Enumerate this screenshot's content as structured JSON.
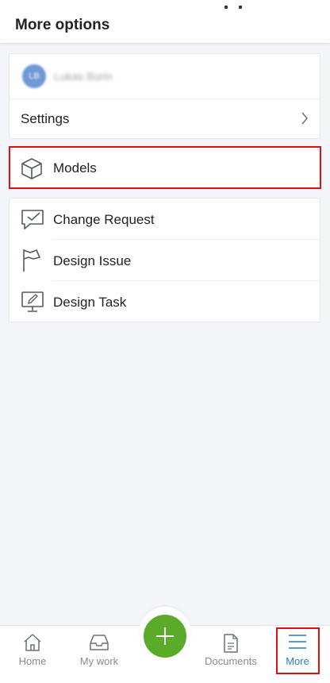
{
  "header": {
    "title": "More options"
  },
  "profile": {
    "initials": "LB",
    "name": "Lukas Burin"
  },
  "settings": {
    "label": "Settings"
  },
  "models": {
    "label": "Models"
  },
  "items": [
    {
      "label": "Change Request",
      "icon": "chat-check-icon"
    },
    {
      "label": "Design Issue",
      "icon": "flag-icon"
    },
    {
      "label": "Design Task",
      "icon": "monitor-pencil-icon"
    }
  ],
  "bottom_nav": {
    "home": "Home",
    "my_work": "My work",
    "documents": "Documents",
    "more": "More"
  },
  "colors": {
    "accent": "#1f7fc2",
    "fab": "#5aab2a",
    "highlight": "#e01010"
  }
}
